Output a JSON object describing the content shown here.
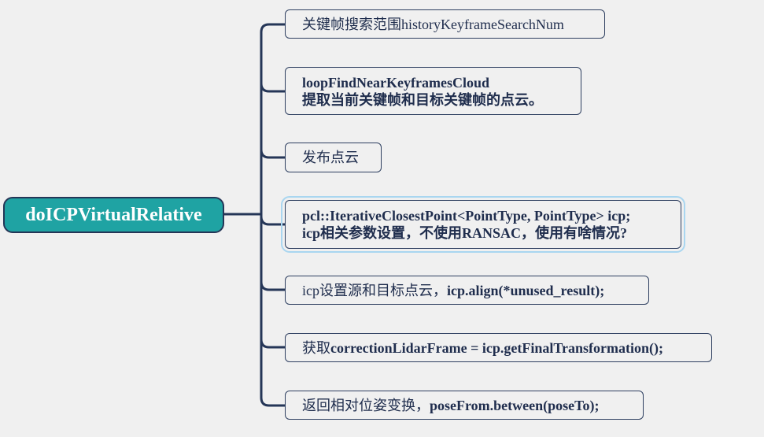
{
  "root": {
    "label": "doICPVirtualRelative",
    "color": "#1fa3a3"
  },
  "children": [
    {
      "lines": [
        [
          {
            "t": "关键帧搜索范围historyKeyframeSearchNum",
            "b": false
          }
        ]
      ]
    },
    {
      "lines": [
        [
          {
            "t": "loopFindNearKeyframesCloud",
            "b": true
          }
        ],
        [
          {
            "t": "提取当前关键帧和目标关键帧的点云。",
            "b": true
          }
        ]
      ]
    },
    {
      "lines": [
        [
          {
            "t": "发布点云",
            "b": false
          }
        ]
      ]
    },
    {
      "selected": true,
      "lines": [
        [
          {
            "t": "pcl::IterativeClosestPoint<PointType, PointType> icp;",
            "b": true
          }
        ],
        [
          {
            "t": "icp相关参数设置，不使用RANSAC，使用有啥情况?",
            "b": true
          }
        ]
      ]
    },
    {
      "lines": [
        [
          {
            "t": "icp设置源和目标点云，",
            "b": false
          },
          {
            "t": "icp.align(*unused_result);",
            "b": true
          }
        ]
      ]
    },
    {
      "lines": [
        [
          {
            "t": "获取",
            "b": false
          },
          {
            "t": "correctionLidarFrame = icp.getFinalTransformation();",
            "b": true
          }
        ]
      ]
    },
    {
      "lines": [
        [
          {
            "t": "返回相对位姿变换，",
            "b": false
          },
          {
            "t": "poseFrom.between(poseTo);",
            "b": true
          }
        ]
      ]
    }
  ]
}
